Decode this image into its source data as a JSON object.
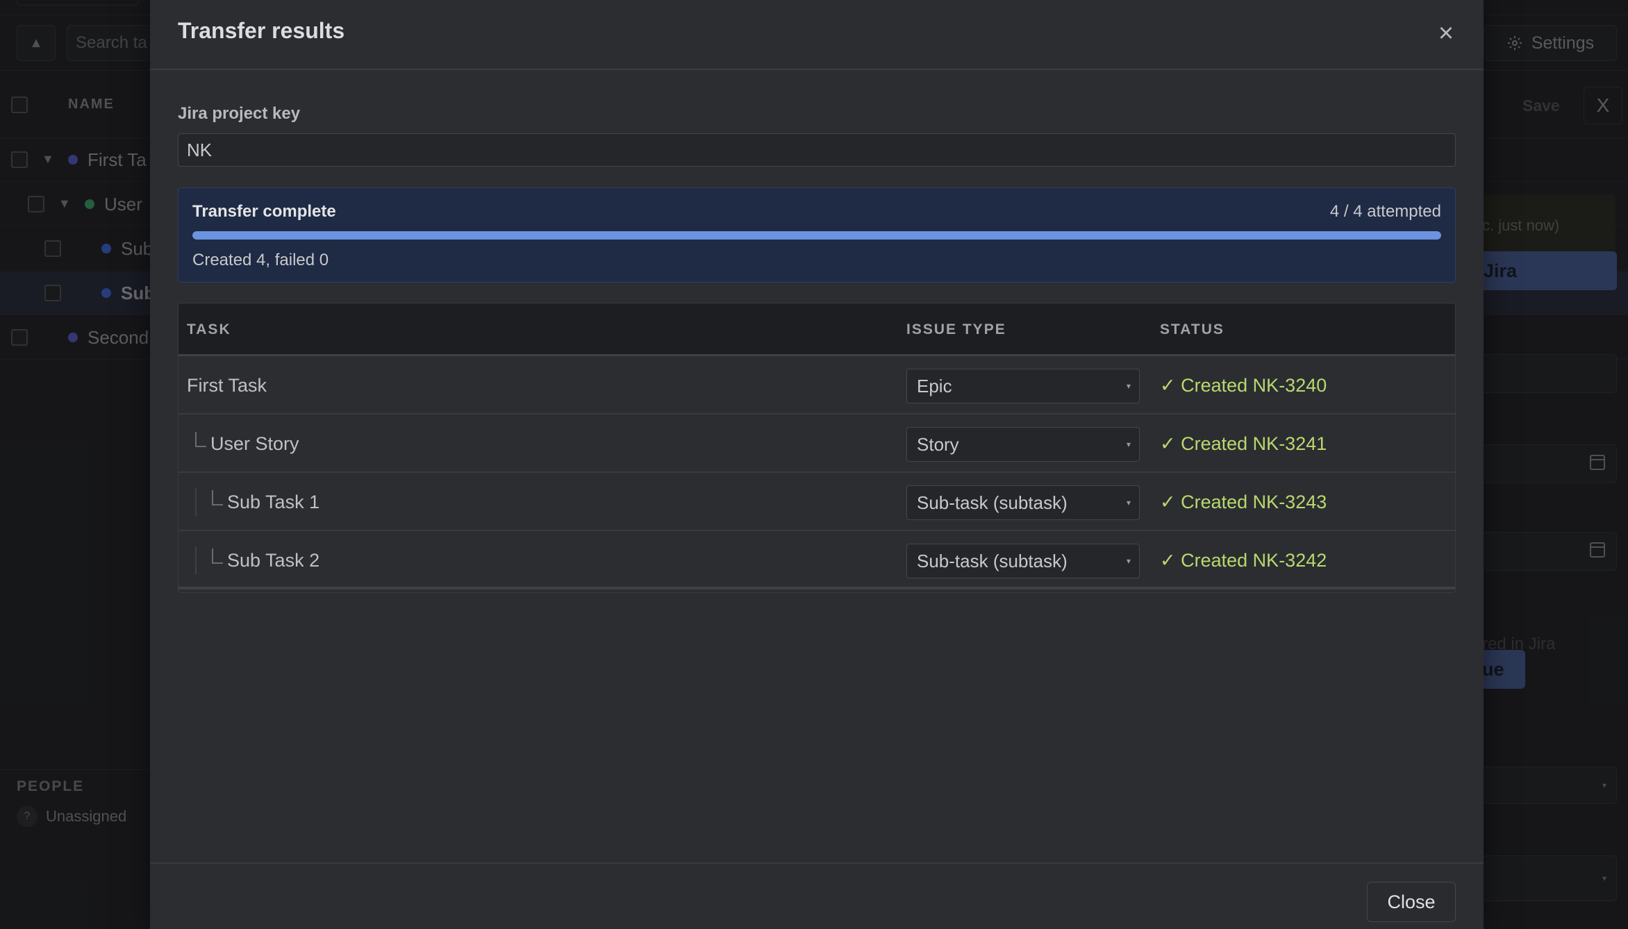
{
  "background": {
    "search_placeholder": "Search ta",
    "settings_label": "Settings",
    "name_column": "NAME",
    "save_label": "Save",
    "close_x_label": "X",
    "rows": [
      {
        "label": "First Ta"
      },
      {
        "label": "User"
      },
      {
        "label": "Sub"
      },
      {
        "label": "Sub"
      },
      {
        "label": "Second"
      }
    ],
    "people_title": "PEOPLE",
    "unassigned_label": "Unassigned",
    "unassigned_icon": "?",
    "right_panel": {
      "status_snippet": "c. just now)",
      "jira_button": "Jira",
      "ghost_text": "red in Jira",
      "issue_button": "ue"
    }
  },
  "modal": {
    "title": "Transfer results",
    "project_key_label": "Jira project key",
    "project_key_value": "NK",
    "progress": {
      "title": "Transfer complete",
      "attempted": "4 / 4 attempted",
      "fraction": 1.0,
      "summary": "Created 4, failed 0"
    },
    "table": {
      "headers": {
        "task": "TASK",
        "issue_type": "ISSUE TYPE",
        "status": "STATUS"
      },
      "rows": [
        {
          "task": "First Task",
          "depth": 0,
          "issue_type": "Epic",
          "status": "✓ Created NK-3240"
        },
        {
          "task": "User Story",
          "depth": 1,
          "issue_type": "Story",
          "status": "✓ Created NK-3241"
        },
        {
          "task": "Sub Task 1",
          "depth": 2,
          "issue_type": "Sub-task (subtask)",
          "status": "✓ Created NK-3243"
        },
        {
          "task": "Sub Task 2",
          "depth": 2,
          "issue_type": "Sub-task (subtask)",
          "status": "✓ Created NK-3242"
        }
      ]
    },
    "close_button": "Close",
    "close_icon": "×"
  },
  "colors": {
    "accent_blue": "#6b93e0",
    "success_green": "#b9d96e",
    "dot_purple": "#5b5fc7",
    "dot_green": "#3fa36b",
    "dot_blue": "#4468d8"
  }
}
